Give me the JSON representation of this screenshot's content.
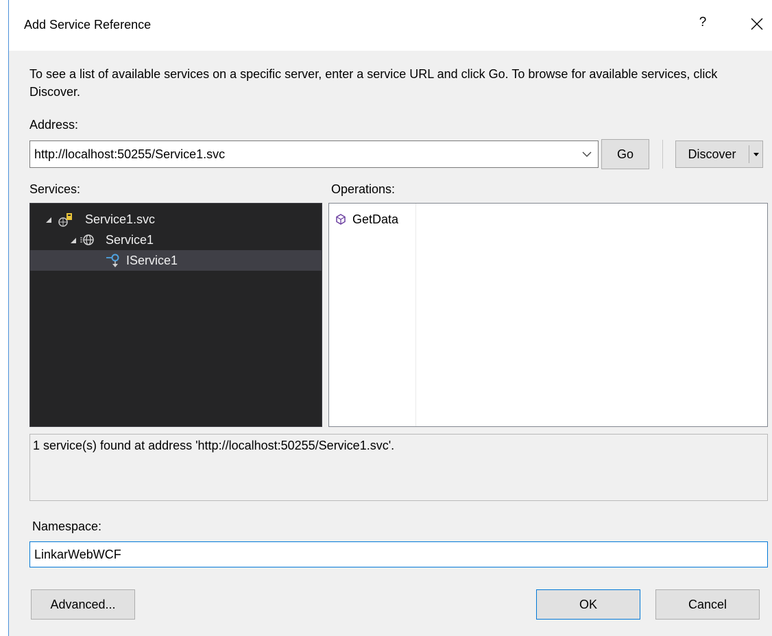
{
  "dialog": {
    "title": "Add Service Reference",
    "help_label": "?",
    "description": "To see a list of available services on a specific server, enter a service URL and click Go. To browse for available services, click Discover."
  },
  "address": {
    "label": "Address:",
    "value": "http://localhost:50255/Service1.svc",
    "go_label": "Go",
    "discover_label": "Discover"
  },
  "services": {
    "label": "Services:",
    "tree": [
      {
        "label": "Service1.svc",
        "icon": "service-file-icon",
        "level": 0,
        "expanded": true
      },
      {
        "label": "Service1",
        "icon": "web-service-icon",
        "level": 1,
        "expanded": true
      },
      {
        "label": "IService1",
        "icon": "interface-icon",
        "level": 2,
        "selected": true
      }
    ]
  },
  "operations": {
    "label": "Operations:",
    "items": [
      {
        "label": "GetData",
        "icon": "method-cube-icon"
      }
    ]
  },
  "status": {
    "message": "1 service(s) found at address 'http://localhost:50255/Service1.svc'."
  },
  "namespace": {
    "label": "Namespace:",
    "value": "LinkarWebWCF"
  },
  "buttons": {
    "advanced_label": "Advanced...",
    "ok_label": "OK",
    "cancel_label": "Cancel"
  },
  "colors": {
    "dialog_bg": "#f0f0f0",
    "tree_bg": "#252526",
    "tree_selected": "#3f3f46",
    "accent": "#0078d7",
    "method_icon": "#6b3fa0"
  }
}
